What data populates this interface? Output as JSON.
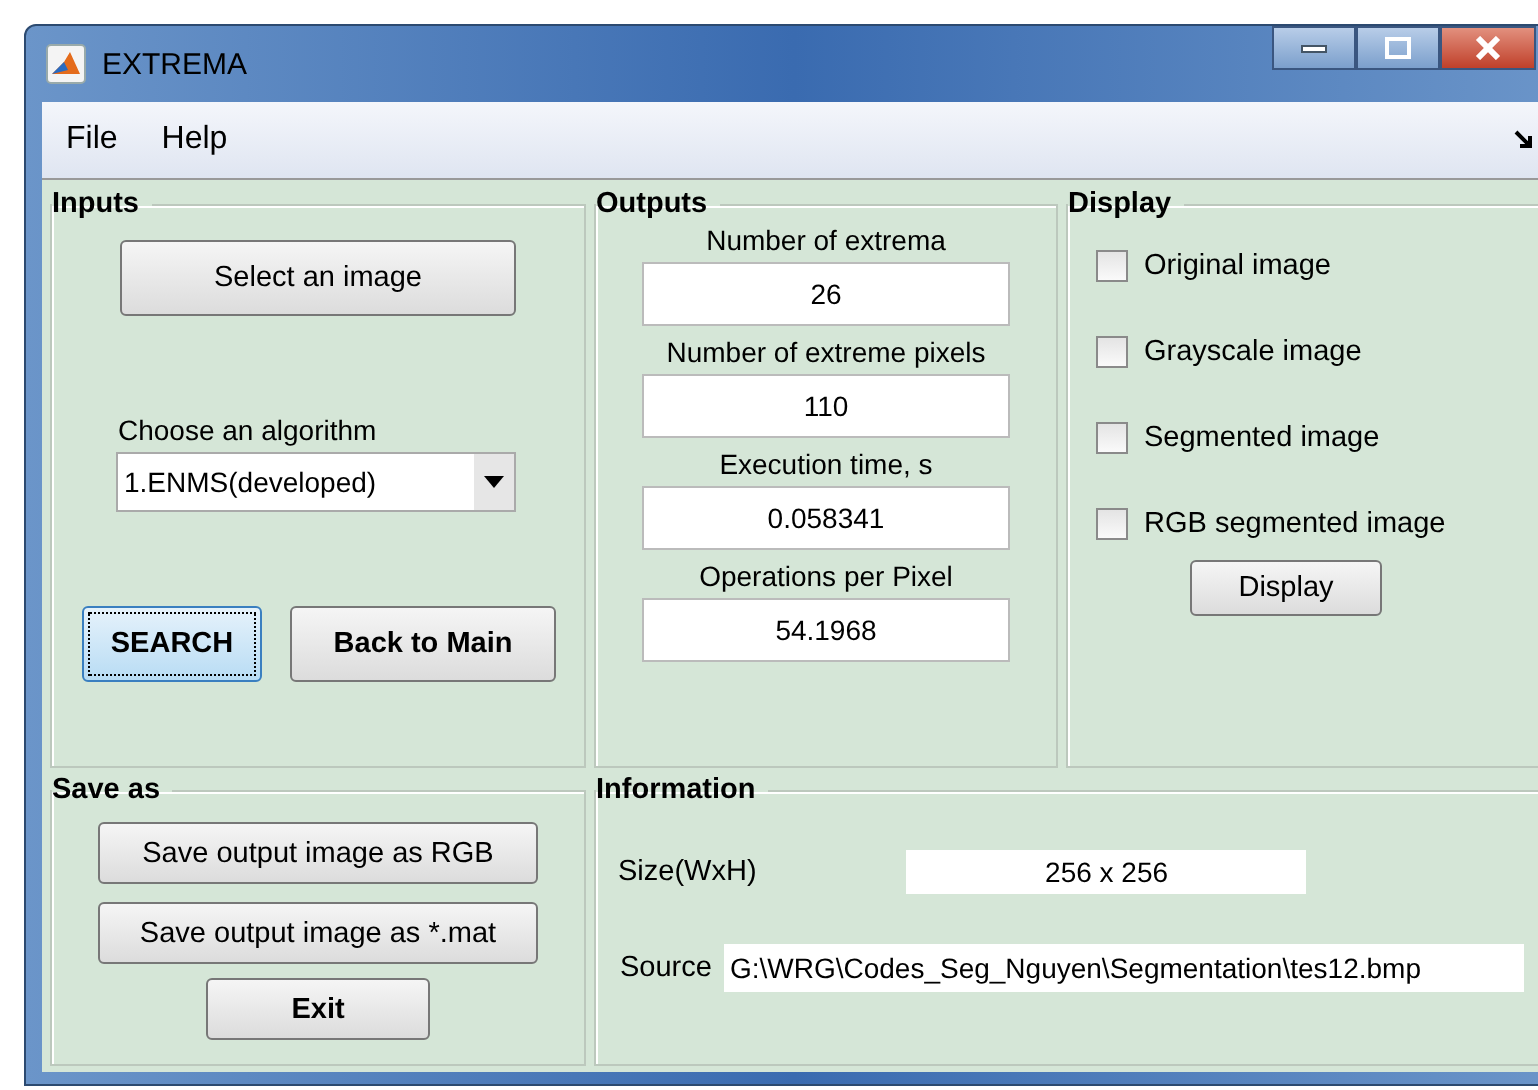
{
  "window": {
    "title": "EXTREMA"
  },
  "menu": [
    "File",
    "Help"
  ],
  "inputs": {
    "title": "Inputs",
    "select_button": {
      "label": "Select an image",
      "focused": false
    },
    "algorithm_label": "Choose an algorithm",
    "algorithm_value": "1.ENMS(developed)",
    "buttons": [
      {
        "label": "SEARCH",
        "focused": true
      },
      {
        "label": "Back to Main",
        "focused": false
      }
    ]
  },
  "outputs": {
    "title": "Outputs",
    "fields": [
      {
        "label": "Number of extrema",
        "value": "26"
      },
      {
        "label": "Number of extreme pixels",
        "value": "110"
      },
      {
        "label": "Execution time, s",
        "value": "0.058341"
      },
      {
        "label": "Operations per Pixel",
        "value": "54.1968"
      }
    ]
  },
  "display": {
    "title": "Display",
    "options": [
      {
        "label": "Original image",
        "checked": false
      },
      {
        "label": "Grayscale image",
        "checked": false
      },
      {
        "label": "Segmented image",
        "checked": false
      },
      {
        "label": "RGB segmented image",
        "checked": false
      }
    ],
    "button": "Display"
  },
  "save_as": {
    "title": "Save as",
    "buttons": [
      "Save output image as RGB",
      "Save output image as *.mat",
      "Exit"
    ]
  },
  "information": {
    "title": "Information",
    "size_label": "Size(WxH)",
    "size_value": "256 x 256",
    "source_label": "Source",
    "source_value": "G:\\WRG\\Codes_Seg_Nguyen\\Segmentation\\tes12.bmp"
  }
}
